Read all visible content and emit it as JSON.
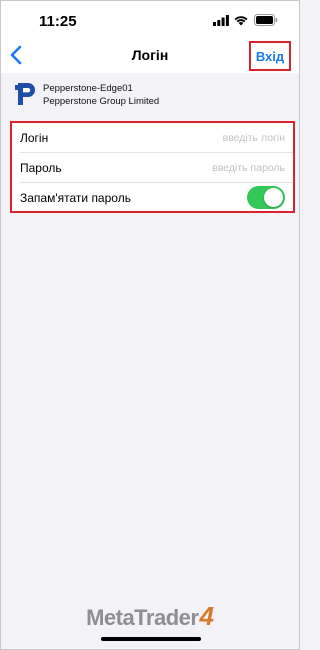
{
  "status_bar": {
    "time": "11:25",
    "icons": [
      "signal-icon",
      "wifi-icon",
      "battery-icon"
    ]
  },
  "nav": {
    "back_icon": "chevron-left-icon",
    "title": "Логін",
    "action_label": "Вхід"
  },
  "server": {
    "logo_icon": "pepperstone-logo-icon",
    "name": "Pepperstone-Edge01",
    "company": "Pepperstone Group Limited"
  },
  "form": {
    "login_label": "Логін",
    "login_placeholder": "введіть логін",
    "login_value": "",
    "password_label": "Пароль",
    "password_placeholder": "введіть пароль",
    "password_value": "",
    "remember_label": "Запам'ятати пароль",
    "remember_enabled": true
  },
  "footer": {
    "brand_text": "MetaTrader",
    "brand_number": "4"
  },
  "colors": {
    "accent": "#1a7af2",
    "toggle_on": "#34c759",
    "highlight": "#d9232d",
    "brand_orange": "#d97a2a"
  }
}
